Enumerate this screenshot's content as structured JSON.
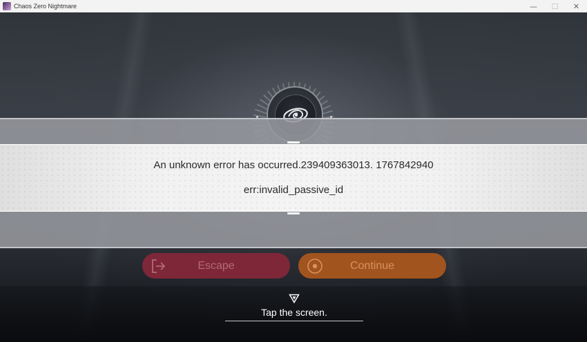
{
  "window": {
    "title": "Chaos Zero Nightmare",
    "controls": {
      "minimize": "—",
      "maximize": "☐",
      "close": "✕"
    }
  },
  "dialog": {
    "message": "An unknown error has occurred.239409363013. 1767842940",
    "detail": "err:invalid_passive_id"
  },
  "buttons": {
    "escape": "Escape",
    "continue": "Continue"
  },
  "footer": {
    "tap_prompt": "Tap the screen."
  },
  "icons": {
    "app": "app-logo-icon",
    "emblem": "swirl-eye-emblem-icon",
    "escape": "exit-door-arrow-icon",
    "continue": "target-circle-icon",
    "tap": "down-triangle-icon"
  },
  "colors": {
    "escape_button": "#7e2738",
    "continue_button": "#a2541e",
    "dialog_band": "#f1f1f1"
  }
}
